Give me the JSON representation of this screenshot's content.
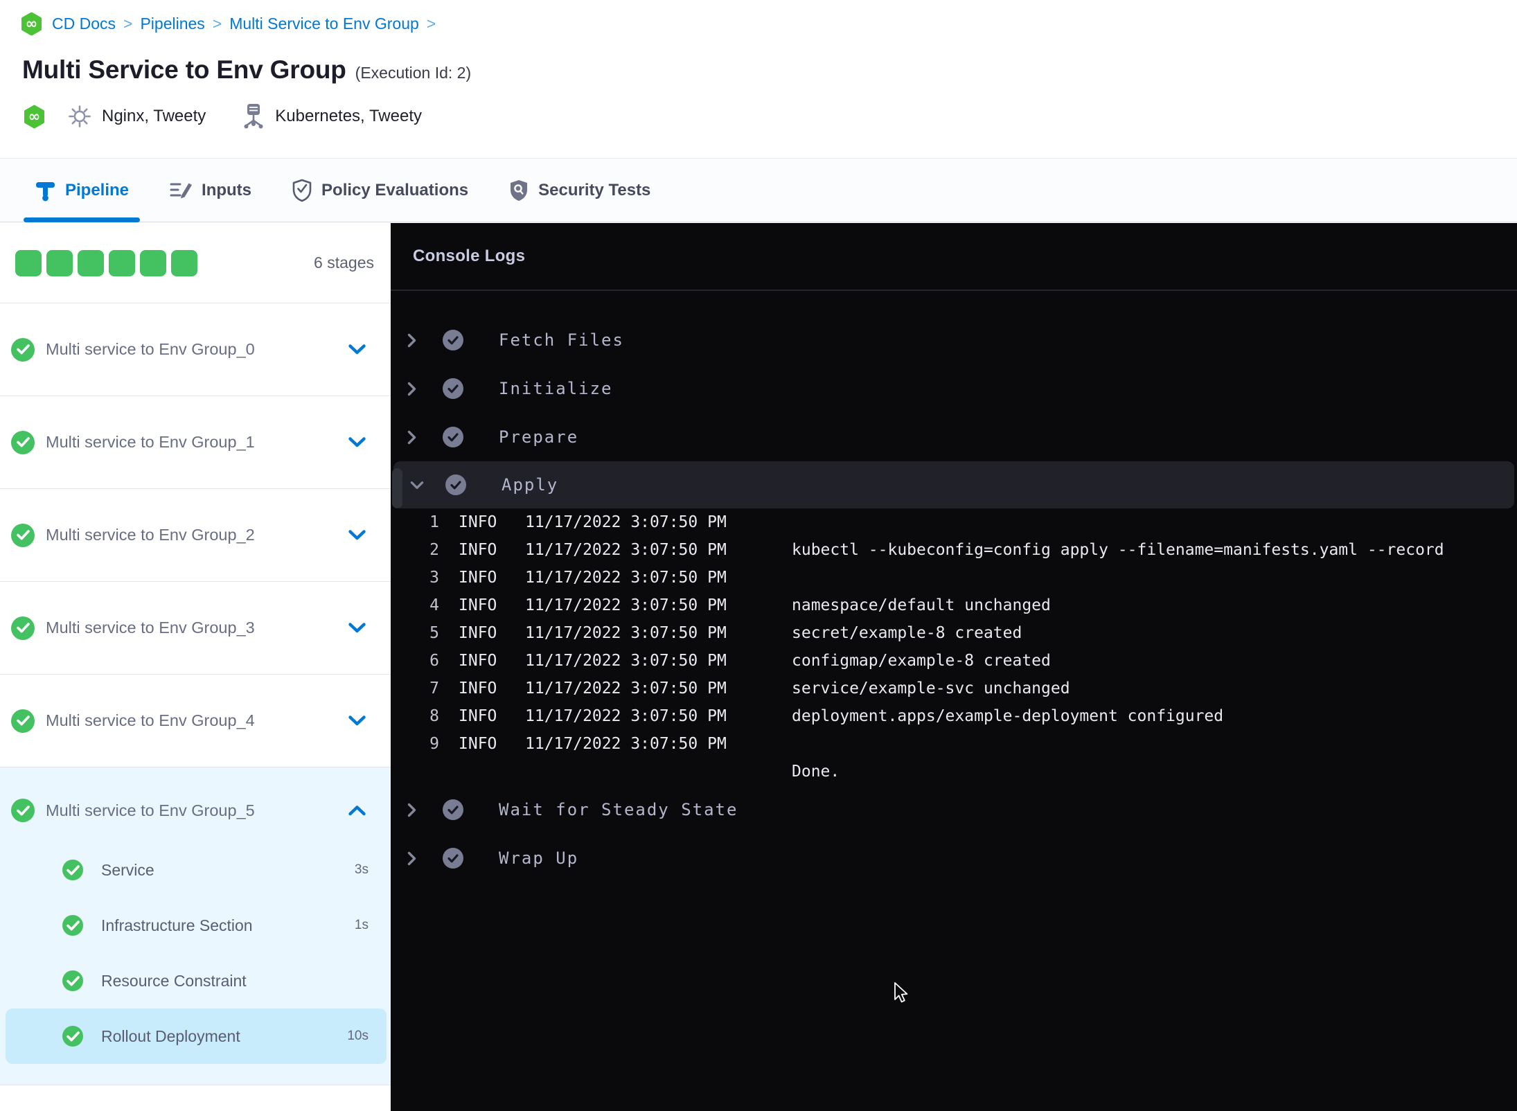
{
  "breadcrumb": {
    "separator": ">",
    "items": [
      {
        "label": "CD Docs"
      },
      {
        "label": "Pipelines"
      },
      {
        "label": "Multi Service to Env Group"
      }
    ]
  },
  "header": {
    "title": "Multi Service to Env Group",
    "execution_id": "(Execution Id: 2)",
    "services_label": "Nginx, Tweety",
    "environments_label": "Kubernetes, Tweety"
  },
  "tabs": [
    {
      "label": "Pipeline",
      "icon": "pipeline-icon",
      "active": true
    },
    {
      "label": "Inputs",
      "icon": "inputs-icon",
      "active": false
    },
    {
      "label": "Policy Evaluations",
      "icon": "policy-icon",
      "active": false
    },
    {
      "label": "Security Tests",
      "icon": "security-icon",
      "active": false
    }
  ],
  "sidebar": {
    "stage_count": 6,
    "stage_count_label": "6 stages",
    "stages": [
      {
        "label": "Multi service to Env Group_0",
        "status": "success",
        "expanded": false
      },
      {
        "label": "Multi service to Env Group_1",
        "status": "success",
        "expanded": false
      },
      {
        "label": "Multi service to Env Group_2",
        "status": "success",
        "expanded": false
      },
      {
        "label": "Multi service to Env Group_3",
        "status": "success",
        "expanded": false
      },
      {
        "label": "Multi service to Env Group_4",
        "status": "success",
        "expanded": false
      },
      {
        "label": "Multi service to Env Group_5",
        "status": "success",
        "expanded": true,
        "steps": [
          {
            "label": "Service",
            "duration": "3s",
            "status": "success",
            "selected": false
          },
          {
            "label": "Infrastructure Section",
            "duration": "1s",
            "status": "success",
            "selected": false
          },
          {
            "label": "Resource Constraint",
            "duration": "",
            "status": "success",
            "selected": false
          },
          {
            "label": "Rollout Deployment",
            "duration": "10s",
            "status": "success",
            "selected": true
          }
        ]
      }
    ]
  },
  "console": {
    "title": "Console Logs",
    "steps": [
      {
        "label": "Fetch Files",
        "status": "success",
        "expanded": false
      },
      {
        "label": "Initialize",
        "status": "success",
        "expanded": false
      },
      {
        "label": "Prepare",
        "status": "success",
        "expanded": false
      },
      {
        "label": "Apply",
        "status": "success",
        "expanded": true
      },
      {
        "label": "Wait for Steady State",
        "status": "success",
        "expanded": false
      },
      {
        "label": "Wrap Up",
        "status": "success",
        "expanded": false
      }
    ],
    "logs": [
      {
        "n": "1",
        "level": "INFO",
        "time": "11/17/2022 3:07:50 PM",
        "msg": ""
      },
      {
        "n": "2",
        "level": "INFO",
        "time": "11/17/2022 3:07:50 PM",
        "msg": "kubectl --kubeconfig=config apply --filename=manifests.yaml --record"
      },
      {
        "n": "3",
        "level": "INFO",
        "time": "11/17/2022 3:07:50 PM",
        "msg": ""
      },
      {
        "n": "4",
        "level": "INFO",
        "time": "11/17/2022 3:07:50 PM",
        "msg": "namespace/default unchanged"
      },
      {
        "n": "5",
        "level": "INFO",
        "time": "11/17/2022 3:07:50 PM",
        "msg": "secret/example-8 created"
      },
      {
        "n": "6",
        "level": "INFO",
        "time": "11/17/2022 3:07:50 PM",
        "msg": "configmap/example-8 created"
      },
      {
        "n": "7",
        "level": "INFO",
        "time": "11/17/2022 3:07:50 PM",
        "msg": "service/example-svc unchanged"
      },
      {
        "n": "8",
        "level": "INFO",
        "time": "11/17/2022 3:07:50 PM",
        "msg": "deployment.apps/example-deployment configured"
      },
      {
        "n": "9",
        "level": "INFO",
        "time": "11/17/2022 3:07:50 PM",
        "msg": ""
      },
      {
        "n": "",
        "level": "",
        "time": "",
        "msg": "Done."
      }
    ]
  },
  "colors": {
    "primary_blue": "#0278d5",
    "success_green": "#44c160",
    "console_bg": "#0a0a0d",
    "selected_step_bg": "#c8ecfb",
    "expanded_stage_bg": "#ebf7fe"
  }
}
